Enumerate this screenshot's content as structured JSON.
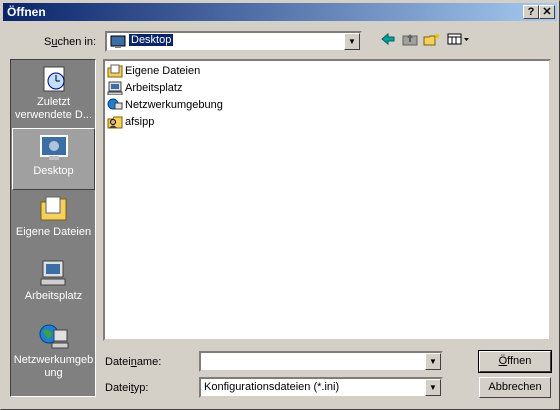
{
  "window": {
    "title": "Öffnen",
    "help_label": "?",
    "close_label": "✕"
  },
  "lookin": {
    "label_pre": "S",
    "label_acc": "u",
    "label_post": "chen in:",
    "value": "Desktop"
  },
  "toolbar": {
    "items": [
      "back-icon",
      "up-folder-icon",
      "new-folder-icon",
      "view-menu-icon"
    ]
  },
  "places": [
    {
      "line1": "Zuletzt",
      "line2": "verwendete D...",
      "icon": "recent-icon"
    },
    {
      "line1": "Desktop",
      "line2": "",
      "icon": "desktop-icon"
    },
    {
      "line1": "Eigene Dateien",
      "line2": "",
      "icon": "my-documents-icon"
    },
    {
      "line1": "Arbeitsplatz",
      "line2": "",
      "icon": "my-computer-icon"
    },
    {
      "line1": "Netzwerkumgeb",
      "line2": "ung",
      "icon": "network-icon"
    }
  ],
  "files": [
    {
      "name": "Eigene Dateien",
      "icon": "folder-docs-icon"
    },
    {
      "name": "Arbeitsplatz",
      "icon": "computer-icon"
    },
    {
      "name": "Netzwerkumgebung",
      "icon": "network-icon"
    },
    {
      "name": "afsipp",
      "icon": "user-folder-icon"
    }
  ],
  "filename": {
    "label_pre": "Datei",
    "label_acc": "n",
    "label_post": "ame:",
    "value": ""
  },
  "filetype": {
    "label_pre": "Datei",
    "label_acc": "t",
    "label_post": "yp:",
    "value": "Konfigurationsdateien (*.ini)"
  },
  "buttons": {
    "open_pre": "Ö",
    "open_post": "ffnen",
    "cancel": "Abbrechen"
  },
  "colors": {
    "titlebar_start": "#0a246a",
    "titlebar_end": "#a6caf0",
    "face": "#d4d0c8",
    "places_bg": "#808080",
    "selection": "#0a246a"
  }
}
